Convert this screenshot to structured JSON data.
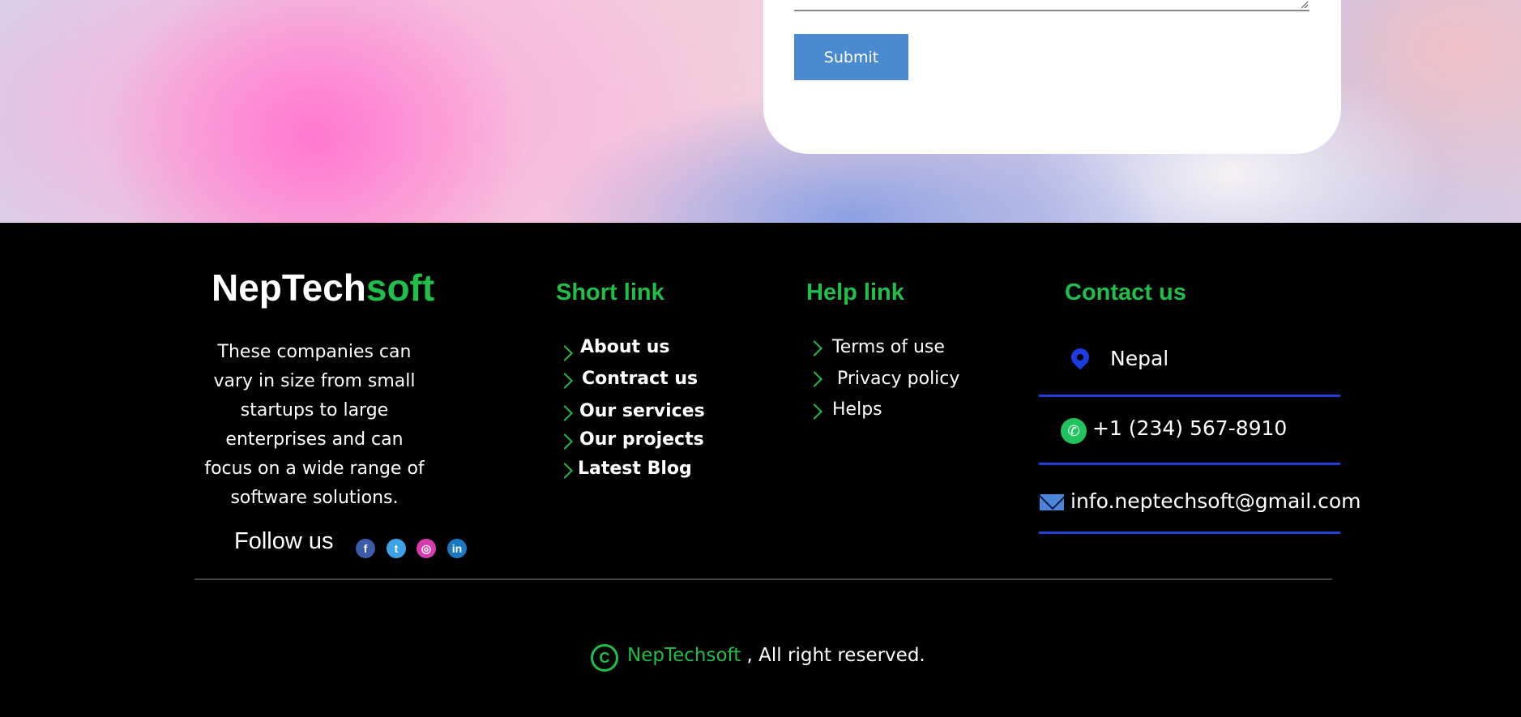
{
  "form": {
    "submit_label": "Submit"
  },
  "footer": {
    "brand": {
      "part1": "NepTech",
      "part2": "soft"
    },
    "about": "These companies can vary in size from small startups to large enterprises and can focus on a wide range of software solutions.",
    "follow_label": "Follow us",
    "social": [
      {
        "name": "facebook",
        "glyph": "f"
      },
      {
        "name": "twitter",
        "glyph": "t"
      },
      {
        "name": "instagram",
        "glyph": "◎"
      },
      {
        "name": "linkedin",
        "glyph": "in"
      }
    ],
    "short_link": {
      "heading": "Short link",
      "items": [
        "About us",
        "Contract us",
        "Our services",
        "Our projects",
        "Latest Blog"
      ]
    },
    "help_link": {
      "heading": "Help link",
      "items": [
        "Terms of use",
        "Privacy policy",
        "Helps"
      ]
    },
    "contact": {
      "heading": "Contact us",
      "location": "Nepal",
      "phone": "+1 (234) 567-8910",
      "email": "info.neptechsoft@gmail.com"
    },
    "copyright": {
      "symbol": "C",
      "brand": "NepTechsoft",
      "text": " , All right reserved."
    },
    "colors": {
      "accent": "#1fbf4a",
      "contact_lines": "#1f3fd6",
      "background": "#000000",
      "submit": "#4a8ad0"
    }
  }
}
